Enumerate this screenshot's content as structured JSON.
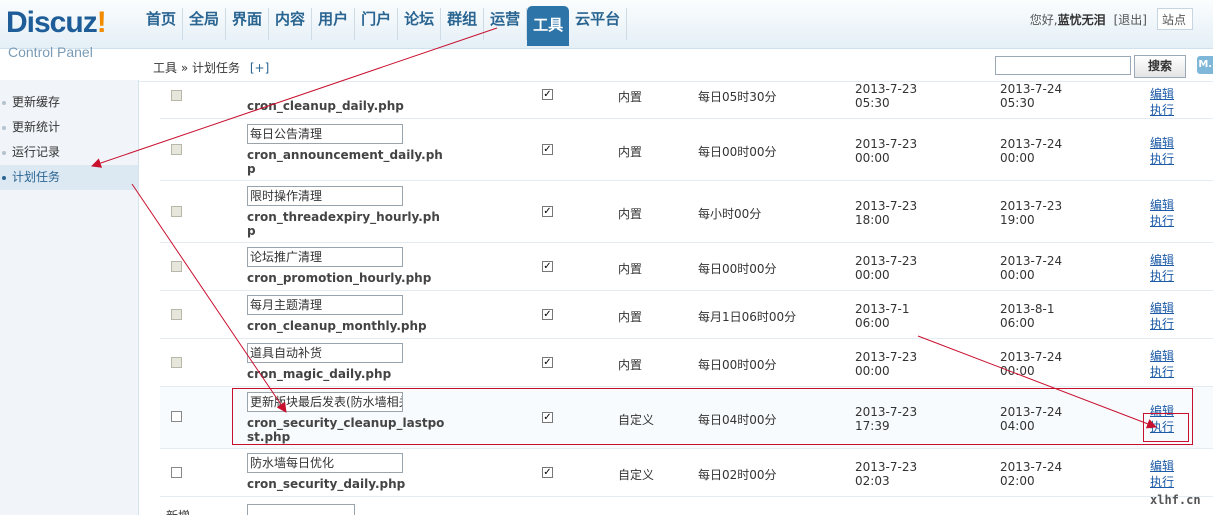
{
  "header": {
    "logo_main": "Discuz",
    "logo_exclaim": "!",
    "logo_sub": "Control Panel",
    "nav": [
      "首页",
      "全局",
      "界面",
      "内容",
      "用户",
      "门户",
      "论坛",
      "群组",
      "运营",
      "工具",
      "云平台"
    ],
    "active_nav": "工具",
    "greeting": "您好,",
    "username": "蓝忧无泪",
    "logout": "[退出]",
    "site_select": "站点"
  },
  "sidebar": {
    "items": [
      "更新缓存",
      "更新统计",
      "运行记录",
      "计划任务"
    ],
    "active": "计划任务"
  },
  "subbar": {
    "breadcrumb_root": "工具",
    "breadcrumb_sep": "»",
    "breadcrumb_current": "计划任务",
    "add_link": "[+]",
    "search_button": "搜索",
    "map_button": "M..."
  },
  "rows": [
    {
      "name": "",
      "file": "cron_cleanup_daily.php",
      "type": "内置",
      "schedule": "每日05时30分",
      "last": "2013-7-23\n05:30",
      "next": "2013-7-24\n05:30",
      "edit": "编辑",
      "run": "执行"
    },
    {
      "name": "每日公告清理",
      "file": "cron_announcement_daily.php",
      "type": "内置",
      "schedule": "每日00时00分",
      "last": "2013-7-23\n00:00",
      "next": "2013-7-24\n00:00",
      "edit": "编辑",
      "run": "执行"
    },
    {
      "name": "限时操作清理",
      "file": "cron_threadexpiry_hourly.php",
      "type": "内置",
      "schedule": "每小时00分",
      "last": "2013-7-23\n18:00",
      "next": "2013-7-23\n19:00",
      "edit": "编辑",
      "run": "执行"
    },
    {
      "name": "论坛推广清理",
      "file": "cron_promotion_hourly.php",
      "type": "内置",
      "schedule": "每日00时00分",
      "last": "2013-7-23\n00:00",
      "next": "2013-7-24\n00:00",
      "edit": "编辑",
      "run": "执行"
    },
    {
      "name": "每月主题清理",
      "file": "cron_cleanup_monthly.php",
      "type": "内置",
      "schedule": "每月1日06时00分",
      "last": "2013-7-1\n06:00",
      "next": "2013-8-1\n06:00",
      "edit": "编辑",
      "run": "执行"
    },
    {
      "name": "道具自动补货",
      "file": "cron_magic_daily.php",
      "type": "内置",
      "schedule": "每日00时00分",
      "last": "2013-7-23\n00:00",
      "next": "2013-7-24\n00:00",
      "edit": "编辑",
      "run": "执行"
    },
    {
      "name": "更新版块最后发表(防水墙相关)",
      "file": "cron_security_cleanup_lastpost.php",
      "type": "自定义",
      "schedule": "每日04时00分",
      "last": "2013-7-23\n17:39",
      "next": "2013-7-24\n04:00",
      "edit": "编辑",
      "run": "执行"
    },
    {
      "name": "防水墙每日优化",
      "file": "cron_security_daily.php",
      "type": "自定义",
      "schedule": "每日02时00分",
      "last": "2013-7-23\n02:03",
      "next": "2013-7-24\n02:00",
      "edit": "编辑",
      "run": "执行"
    }
  ],
  "add_row_label": "新增",
  "watermark": "xlhf.cn",
  "colors": {
    "nav_active": "#2d74a8",
    "link": "#1b5aa6",
    "annotation": "#c8102e"
  }
}
